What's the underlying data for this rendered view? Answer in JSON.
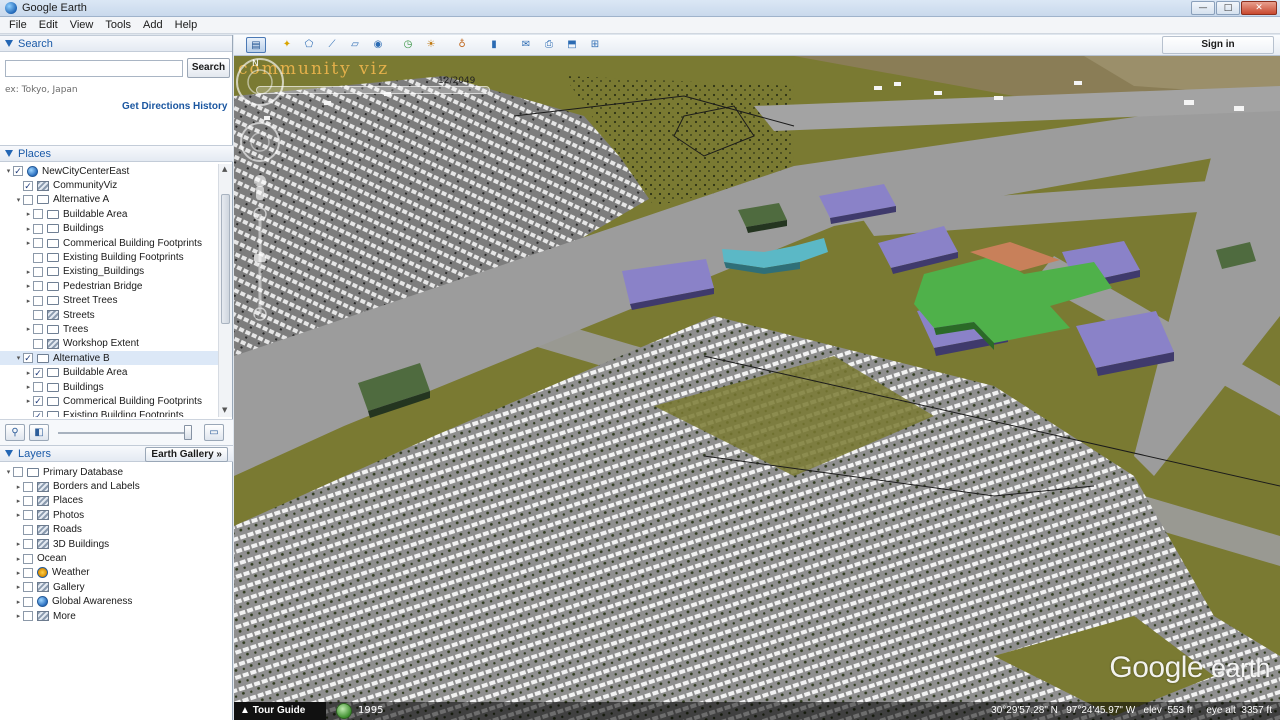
{
  "window": {
    "title": "Google Earth",
    "btn_min": "—",
    "btn_max": "□",
    "btn_close": "✕"
  },
  "menu": [
    "File",
    "Edit",
    "View",
    "Tools",
    "Add",
    "Help"
  ],
  "search": {
    "header": "Search",
    "button_label": "Search",
    "hint": "ex: Tokyo, Japan",
    "get_directions": "Get Directions",
    "history": "History",
    "value": "",
    "placeholder": ""
  },
  "places": {
    "header": "Places",
    "items": [
      {
        "label": "NewCityCenterEast",
        "indent": 0,
        "expand": "▾",
        "checked": true,
        "icon": "globe"
      },
      {
        "label": "CommunityViz",
        "indent": 1,
        "expand": "",
        "checked": true,
        "icon": "layer"
      },
      {
        "label": "Alternative A",
        "indent": 1,
        "expand": "▾",
        "checked": false,
        "icon": "folder"
      },
      {
        "label": "Buildable Area",
        "indent": 2,
        "expand": "▸",
        "checked": false,
        "icon": "folder"
      },
      {
        "label": "Buildings",
        "indent": 2,
        "expand": "▸",
        "checked": false,
        "icon": "folder"
      },
      {
        "label": "Commerical Building Footprints",
        "indent": 2,
        "expand": "▸",
        "checked": false,
        "icon": "folder"
      },
      {
        "label": "Existing Building Footprints",
        "indent": 2,
        "expand": "",
        "checked": false,
        "icon": "folder"
      },
      {
        "label": "Existing_Buildings",
        "indent": 2,
        "expand": "▸",
        "checked": false,
        "icon": "folder"
      },
      {
        "label": "Pedestrian Bridge",
        "indent": 2,
        "expand": "▸",
        "checked": false,
        "icon": "folder"
      },
      {
        "label": "Street Trees",
        "indent": 2,
        "expand": "▸",
        "checked": false,
        "icon": "folder"
      },
      {
        "label": "Streets",
        "indent": 2,
        "expand": "",
        "checked": false,
        "icon": "dots"
      },
      {
        "label": "Trees",
        "indent": 2,
        "expand": "▸",
        "checked": false,
        "icon": "folder"
      },
      {
        "label": "Workshop Extent",
        "indent": 2,
        "expand": "",
        "checked": false,
        "icon": "layer"
      },
      {
        "label": "Alternative B",
        "indent": 1,
        "expand": "▾",
        "checked": true,
        "icon": "folder",
        "selected": true
      },
      {
        "label": "Buildable Area",
        "indent": 2,
        "expand": "▸",
        "checked": true,
        "icon": "folder"
      },
      {
        "label": "Buildings",
        "indent": 2,
        "expand": "▸",
        "checked": false,
        "icon": "folder"
      },
      {
        "label": "Commerical Building Footprints",
        "indent": 2,
        "expand": "▸",
        "checked": true,
        "icon": "folder"
      },
      {
        "label": "Existing Building Footprints",
        "indent": 2,
        "expand": "",
        "checked": true,
        "icon": "folder"
      }
    ]
  },
  "layers": {
    "header": "Layers",
    "gallery_button": "Earth Gallery »",
    "items": [
      {
        "label": "Primary Database",
        "indent": 0,
        "expand": "▾",
        "checked": false,
        "icon": "folder"
      },
      {
        "label": "Borders and Labels",
        "indent": 1,
        "expand": "▸",
        "checked": false,
        "icon": "layer"
      },
      {
        "label": "Places",
        "indent": 1,
        "expand": "▸",
        "checked": false,
        "icon": "layer"
      },
      {
        "label": "Photos",
        "indent": 1,
        "expand": "▸",
        "checked": false,
        "icon": "layer"
      },
      {
        "label": "Roads",
        "indent": 1,
        "expand": "",
        "checked": false,
        "icon": "layer"
      },
      {
        "label": "3D Buildings",
        "indent": 1,
        "expand": "▸",
        "checked": false,
        "icon": "layer"
      },
      {
        "label": "Ocean",
        "indent": 1,
        "expand": "▸",
        "checked": false,
        "icon": "none"
      },
      {
        "label": "Weather",
        "indent": 1,
        "expand": "▸",
        "checked": false,
        "icon": "sun"
      },
      {
        "label": "Gallery",
        "indent": 1,
        "expand": "▸",
        "checked": false,
        "icon": "layer"
      },
      {
        "label": "Global Awareness",
        "indent": 1,
        "expand": "▸",
        "checked": false,
        "icon": "globe"
      },
      {
        "label": "More",
        "indent": 1,
        "expand": "▸",
        "checked": false,
        "icon": "layer"
      }
    ]
  },
  "toolbar": {
    "sign_in": "Sign in"
  },
  "map": {
    "overlay_text_a": "commun",
    "overlay_text_b": "ity viz",
    "time_label": "12/2049",
    "logo_a": "Google",
    "logo_b": "earth",
    "tour_guide": "Tour Guide",
    "history_year": "1995",
    "latitude": "30°29'57.28\" N",
    "longitude": "97°24'45.97\" W",
    "elev_label": "elev",
    "elevation": "553 ft",
    "eye_alt_label": "eye alt",
    "eye_altitude": "3357 ft"
  },
  "colors": {
    "accent": "#1b5aa8",
    "ground": "#7a7a32",
    "road": "#9a9a9a",
    "building_purple": "#8a82c8",
    "building_green": "#4fb14a",
    "building_orange": "#c8805a",
    "building_teal": "#5bb8c6"
  }
}
